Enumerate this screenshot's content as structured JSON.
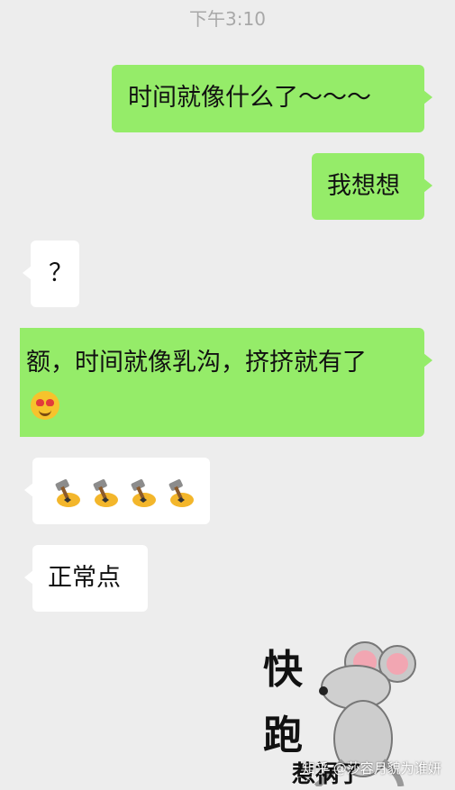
{
  "status": {
    "timestamp": "下午3:10"
  },
  "messages": [
    {
      "side": "out",
      "text": "时间就像什么了～～～"
    },
    {
      "side": "out",
      "text": "我想想"
    },
    {
      "side": "in",
      "text": "？"
    },
    {
      "side": "out",
      "text": "额，时间就像乳沟，挤挤就有了",
      "emoji": "heart-eyes-face"
    },
    {
      "side": "in",
      "emoji": "hammer",
      "count": 4
    },
    {
      "side": "in",
      "text": "正常点"
    }
  ],
  "sticker": {
    "line1": "快",
    "line2": "跑",
    "line3": "惹祸了"
  },
  "watermark": "知乎 @莎容月貌为谁妍",
  "colors": {
    "outgoing": "#95ec69",
    "incoming": "#ffffff",
    "background": "#ededed"
  }
}
